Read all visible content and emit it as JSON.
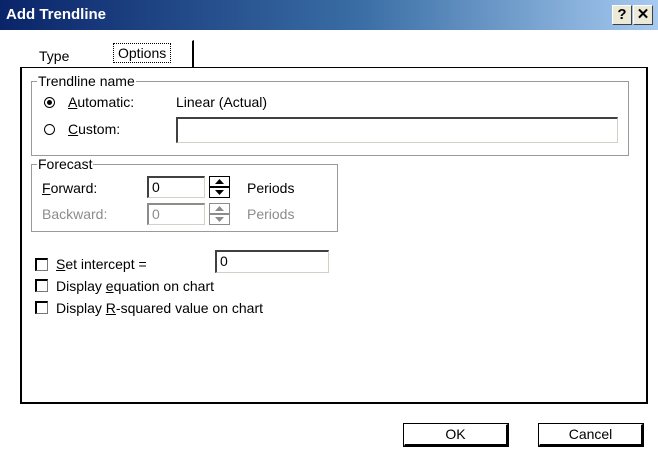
{
  "window": {
    "title": "Add Trendline",
    "help_glyph": "?",
    "close_glyph": "✕"
  },
  "tabs": [
    {
      "label": "Type",
      "active": false
    },
    {
      "label": "Options",
      "active": true
    }
  ],
  "trendline_name": {
    "group_label": "Trendline name",
    "automatic": {
      "prefix": "",
      "accel": "A",
      "rest": "utomatic:",
      "value": "Linear (Actual)",
      "selected": true
    },
    "custom": {
      "accel": "C",
      "rest": "ustom:",
      "value": "",
      "selected": false
    }
  },
  "forecast": {
    "group_label": "Forecast",
    "forward": {
      "accel": "F",
      "rest": "orward:",
      "value": "0",
      "unit": "Periods",
      "enabled": true
    },
    "backward": {
      "label": "Backward:",
      "value": "0",
      "unit": "Periods",
      "enabled": false
    }
  },
  "options": {
    "set_intercept": {
      "pre": "",
      "accel": "S",
      "post": "et intercept =",
      "value": "0",
      "checked": false
    },
    "display_equation": {
      "pre": "Display ",
      "accel": "e",
      "post": "quation on chart",
      "checked": false
    },
    "display_r_squared": {
      "pre": "Display ",
      "accel": "R",
      "post": "-squared value on chart",
      "checked": false
    }
  },
  "buttons": {
    "ok": "OK",
    "cancel": "Cancel"
  }
}
